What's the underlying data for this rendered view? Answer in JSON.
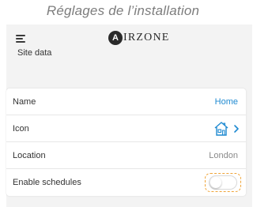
{
  "caption": "Réglages de l’installation",
  "header": {
    "logo_mark": "A",
    "logo_text": "IRZONE",
    "menu_icon": "hamburger-menu-icon"
  },
  "section": {
    "title": "Site data"
  },
  "rows": [
    {
      "label": "Name",
      "value": "Home"
    },
    {
      "label": "Icon",
      "icon": "house-icon"
    },
    {
      "label": "Location",
      "value": "London"
    },
    {
      "label": "Enable schedules",
      "toggle_on": false
    }
  ],
  "colors": {
    "link": "#1f8ad1",
    "highlight": "#f0a53a",
    "background": "#f3f3f3"
  }
}
